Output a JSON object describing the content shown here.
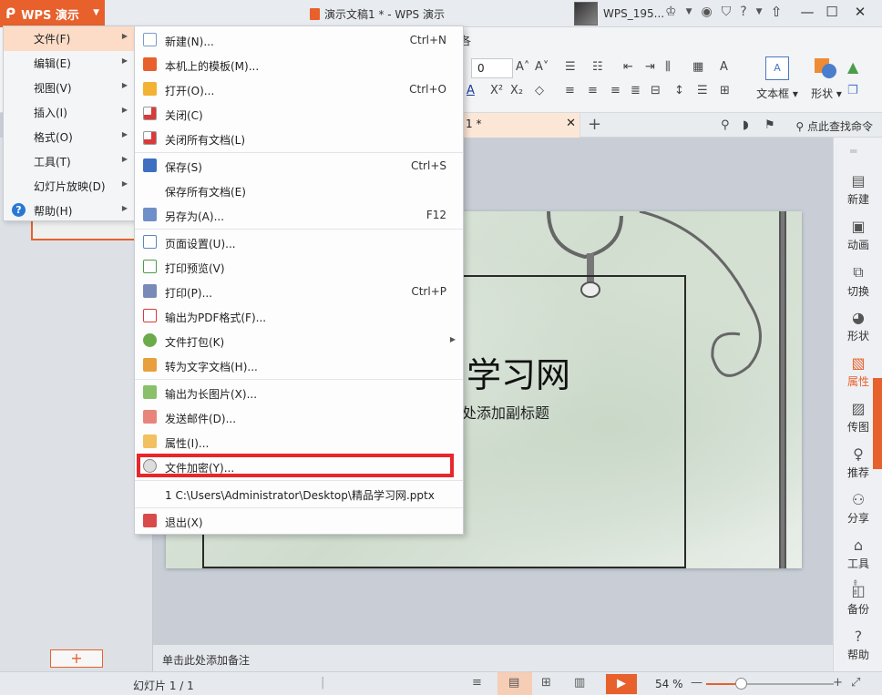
{
  "app": {
    "menu_button_label": "WPS 演示",
    "doc_title": "演示文稿1 * - WPS 演示",
    "username": "WPS_195..."
  },
  "ribbon": {
    "tab_hint": "各",
    "font_size_value": "0",
    "textbox_label": "文本框",
    "shape_label": "形状"
  },
  "doc_tabs": {
    "active_tab": "1 *",
    "find_command": "点此查找命令"
  },
  "main_menu": [
    {
      "label": "文件(F)"
    },
    {
      "label": "编辑(E)"
    },
    {
      "label": "视图(V)"
    },
    {
      "label": "插入(I)"
    },
    {
      "label": "格式(O)"
    },
    {
      "label": "工具(T)"
    },
    {
      "label": "幻灯片放映(D)"
    },
    {
      "label": "帮助(H)"
    }
  ],
  "file_menu": [
    {
      "label": "新建(N)...",
      "shortcut": "Ctrl+N",
      "icon": "new-doc-icon"
    },
    {
      "label": "本机上的模板(M)...",
      "shortcut": "",
      "icon": "template-icon"
    },
    {
      "label": "打开(O)...",
      "shortcut": "Ctrl+O",
      "icon": "open-folder-icon"
    },
    {
      "label": "关闭(C)",
      "shortcut": "",
      "icon": "close-doc-icon"
    },
    {
      "label": "关闭所有文档(L)",
      "shortcut": "",
      "icon": "close-all-icon"
    },
    {
      "label": "保存(S)",
      "shortcut": "Ctrl+S",
      "icon": "save-icon"
    },
    {
      "label": "保存所有文档(E)",
      "shortcut": "",
      "icon": ""
    },
    {
      "label": "另存为(A)...",
      "shortcut": "F12",
      "icon": "save-as-icon"
    },
    {
      "label": "页面设置(U)...",
      "shortcut": "",
      "icon": "page-setup-icon"
    },
    {
      "label": "打印预览(V)",
      "shortcut": "",
      "icon": "print-preview-icon"
    },
    {
      "label": "打印(P)...",
      "shortcut": "Ctrl+P",
      "icon": "printer-icon"
    },
    {
      "label": "输出为PDF格式(F)...",
      "shortcut": "",
      "icon": "pdf-icon"
    },
    {
      "label": "文件打包(K)",
      "shortcut": "",
      "icon": "package-icon"
    },
    {
      "label": "转为文字文档(H)...",
      "shortcut": "",
      "icon": "convert-icon"
    },
    {
      "label": "输出为长图片(X)...",
      "shortcut": "",
      "icon": "image-export-icon"
    },
    {
      "label": "发送邮件(D)...",
      "shortcut": "",
      "icon": "mail-icon"
    },
    {
      "label": "属性(I)...",
      "shortcut": "",
      "icon": "properties-icon"
    },
    {
      "label": "文件加密(Y)...",
      "shortcut": "",
      "icon": "encrypt-icon"
    },
    {
      "label": "1 C:\\Users\\Administrator\\Desktop\\精品学习网.pptx",
      "shortcut": "",
      "icon": ""
    },
    {
      "label": "退出(X)",
      "shortcut": "",
      "icon": "exit-icon"
    }
  ],
  "slide": {
    "title": "学习网",
    "subtitle": "处添加副标题"
  },
  "right_sidebar": [
    {
      "label": "新建",
      "icon": "new-page-icon"
    },
    {
      "label": "动画",
      "icon": "animation-icon"
    },
    {
      "label": "切换",
      "icon": "transition-icon"
    },
    {
      "label": "形状",
      "icon": "shape-icon"
    },
    {
      "label": "属性",
      "icon": "property-icon"
    },
    {
      "label": "传图",
      "icon": "upload-image-icon"
    },
    {
      "label": "推荐",
      "icon": "recommend-icon"
    },
    {
      "label": "分享",
      "icon": "share-icon"
    },
    {
      "label": "工具",
      "icon": "toolbox-icon"
    },
    {
      "label": "备份",
      "icon": "backup-icon"
    },
    {
      "label": "帮助",
      "icon": "help-icon"
    }
  ],
  "notes_placeholder": "单击此处添加备注",
  "status": {
    "slide_count": "幻灯片 1 / 1",
    "zoom": "54 %",
    "zoom_fraction": 0.27
  },
  "colors": {
    "accent": "#e8602c",
    "highlight_box": "#e8262b"
  }
}
